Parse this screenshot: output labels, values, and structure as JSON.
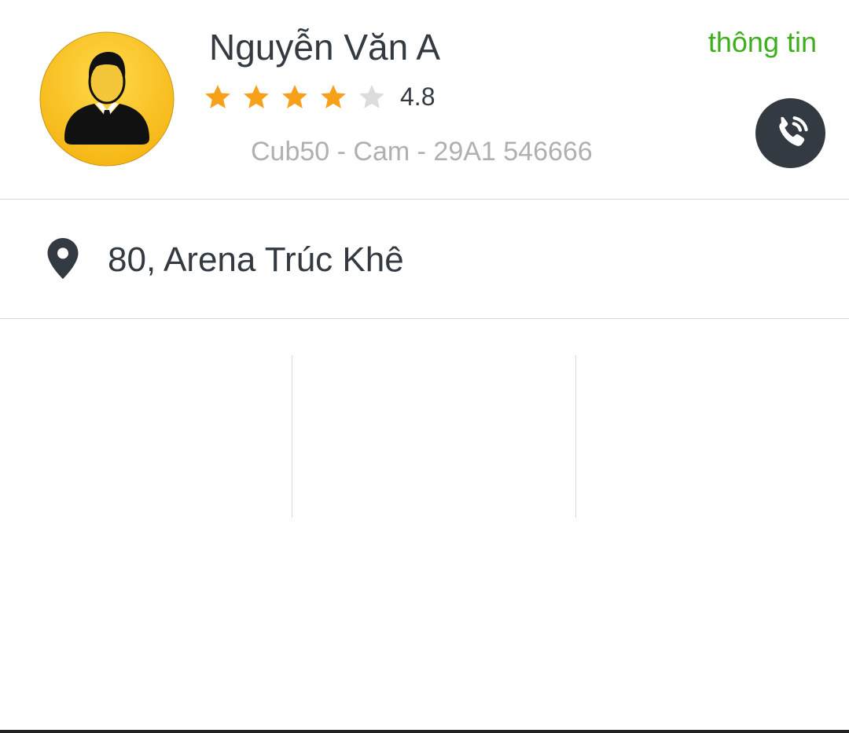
{
  "driver": {
    "name": "Nguyễn Văn A",
    "rating": 4.8,
    "rating_label": "4.8",
    "stars_filled": 4,
    "stars_total": 5,
    "vehicle": "Cub50 - Cam - 29A1 546666",
    "avatar_icon": "driver-avatar-icon",
    "call_icon": "phone-call-icon"
  },
  "header": {
    "info_link": "thông tin"
  },
  "pickup": {
    "icon": "location-pin-icon",
    "address": "80, Arena Trúc Khê"
  },
  "colors": {
    "accent_green": "#3fae1c",
    "star_filled": "#f7a01a",
    "star_empty": "#dcdcdc",
    "dark": "#333a42",
    "muted_text": "#b0b0b0",
    "avatar_yellow": "#fbc12b"
  }
}
